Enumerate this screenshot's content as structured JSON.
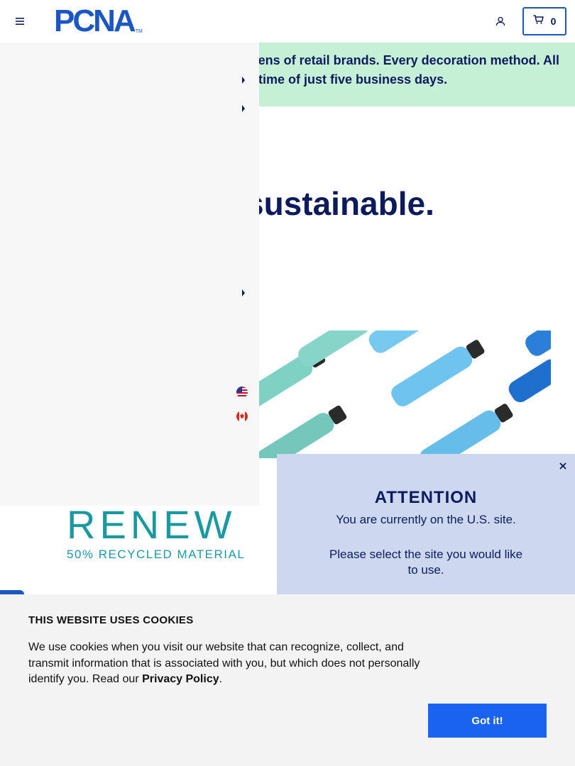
{
  "header": {
    "logo_text": "PCNA",
    "logo_tm": "TM",
    "cart_count": "0"
  },
  "banner": {
    "line1": "ens of retail brands. Every decoration method. All",
    "line2": "time of just five business days."
  },
  "hero": {
    "headline": "sustainable."
  },
  "renew": {
    "word": "RENEW",
    "subtitle": "50% RECYCLED MATERIAL"
  },
  "attention": {
    "title": "ATTENTION",
    "line1": "You are currently on the U.S. site.",
    "line2": "Please select the site you would like to use."
  },
  "cookie": {
    "title": "THIS WEBSITE USES COOKIES",
    "body_prefix": "We use cookies when you visit our website that can recognize, collect, and transmit information that is associated with you, but which does not personally identify you. Read our ",
    "policy_link": "Privacy Policy",
    "body_suffix": ".",
    "button": "Got it!"
  },
  "colors": {
    "brand_blue": "#1a56c4",
    "navy": "#0d1b5e",
    "banner_green": "#c5f0d6",
    "attention_bg": "#cdd8ef",
    "button_blue": "#1a63f0",
    "renew_teal": "#1a9aa0"
  },
  "icons": {
    "menu": "hamburger-icon",
    "account": "user-icon",
    "cart": "cart-icon",
    "close": "close-icon",
    "caret": "caret-right-icon",
    "flag_us": "us-flag-icon",
    "flag_ca": "canada-flag-icon"
  }
}
